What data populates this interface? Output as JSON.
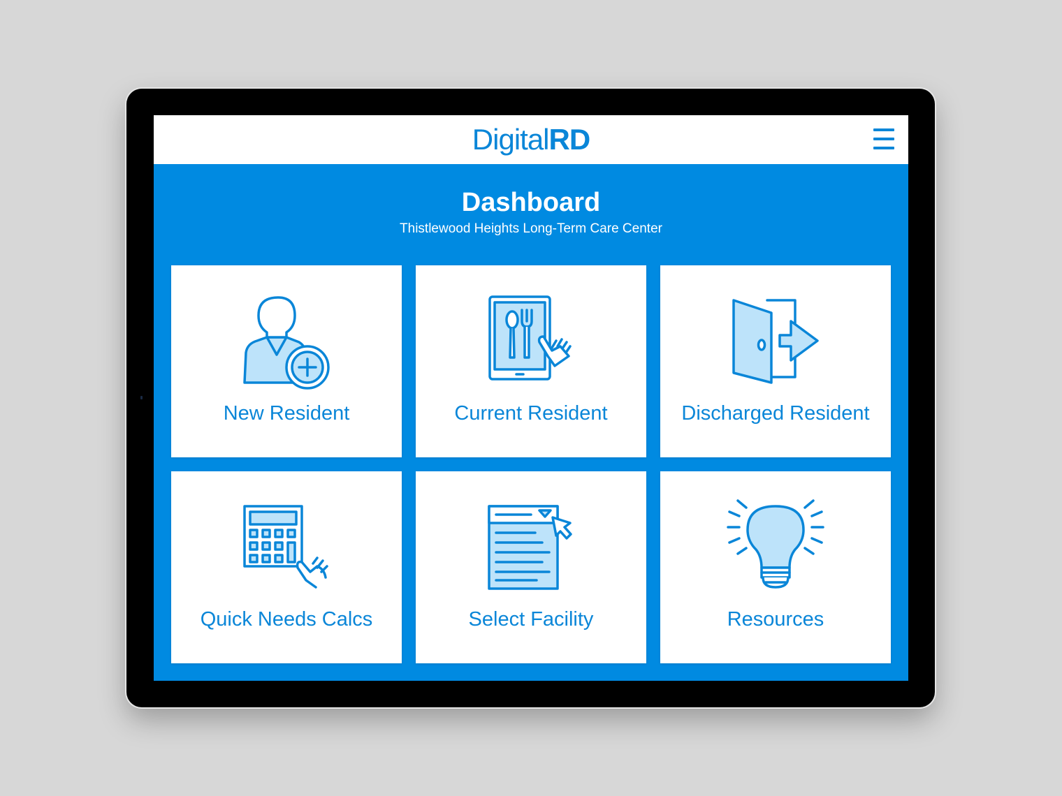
{
  "app": {
    "logo_light": "Digital",
    "logo_bold": "RD",
    "menu_icon": "hamburger-menu-icon"
  },
  "header": {
    "title": "Dashboard",
    "subtitle": "Thistlewood Heights Long-Term Care Center"
  },
  "tiles": [
    {
      "label": "New Resident",
      "icon": "add-person-icon"
    },
    {
      "label": "Current Resident",
      "icon": "tablet-menu-icon"
    },
    {
      "label": "Discharged Resident",
      "icon": "exit-door-icon"
    },
    {
      "label": "Quick Needs Calcs",
      "icon": "calculator-icon"
    },
    {
      "label": "Select Facility",
      "icon": "dropdown-list-icon"
    },
    {
      "label": "Resources",
      "icon": "lightbulb-icon"
    }
  ],
  "colors": {
    "brand_blue": "#008ae1",
    "icon_blue": "#0a86d8",
    "icon_fill": "#bde3fa",
    "tile_bg": "#ffffff",
    "page_bg": "#d7d7d7",
    "bezel": "#000000"
  }
}
